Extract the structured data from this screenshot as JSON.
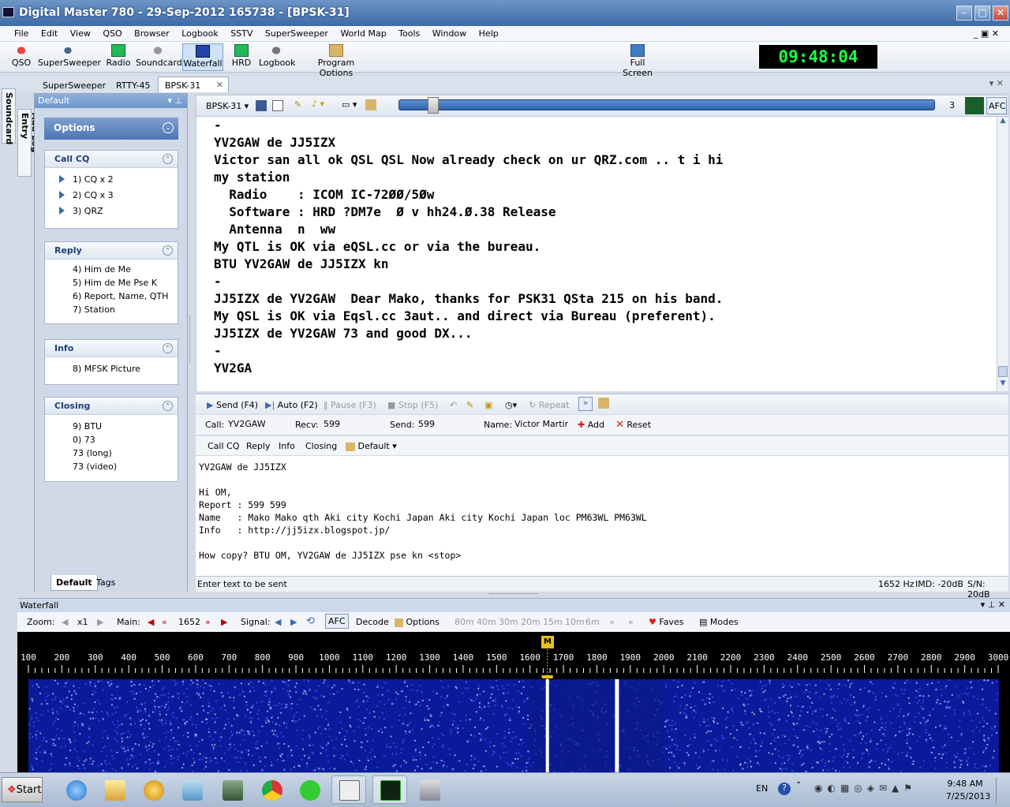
{
  "window": {
    "title": "Digital Master 780 - 29-Sep-2012 165738 - [BPSK-31]"
  },
  "menu": [
    "File",
    "Edit",
    "View",
    "QSO",
    "Browser",
    "Logbook",
    "SSTV",
    "SuperSweeper",
    "World Map",
    "Tools",
    "Window",
    "Help"
  ],
  "toolbar": {
    "buttons": [
      {
        "label": "QSO"
      },
      {
        "label": "SuperSweeper"
      },
      {
        "label": "Radio"
      },
      {
        "label": "Soundcard"
      },
      {
        "label": "Waterfall"
      },
      {
        "label": "HRD"
      },
      {
        "label": "Logbook"
      },
      {
        "label": "Program Options"
      },
      {
        "label": "Full Screen"
      }
    ],
    "clock": "09:48:04"
  },
  "doc_tabs": [
    "SuperSweeper",
    "RTTY-45",
    "BPSK-31"
  ],
  "side_tabs": [
    "Soundcard",
    "Add Log Entry"
  ],
  "left_panel": {
    "title": "Default",
    "options_label": "Options",
    "sections": [
      {
        "title": "Call CQ",
        "items": [
          "1)  CQ x 2",
          "2)  CQ x 3",
          "3)  QRZ"
        ]
      },
      {
        "title": "Reply",
        "items": [
          "4)  Him de Me",
          "5)  Him de Me Pse K",
          "6)  Report, Name, QTH",
          "7)  Station"
        ]
      },
      {
        "title": "Info",
        "items": [
          "8)  MFSK Picture"
        ]
      },
      {
        "title": "Closing",
        "items": [
          "9)  BTU",
          "0)  73",
          "73 (long)",
          "73 (video)"
        ]
      }
    ],
    "footer_tabs": [
      "Default",
      "Tags"
    ]
  },
  "rx_toolbar": {
    "mode": "BPSK-31",
    "level": "3",
    "afc": "AFC"
  },
  "rx_lines": [
    "-",
    "YV2GAW de JJ5IZX",
    "Victor san all ok QSL QSL Now already check on ur QRZ.com .. t i hi",
    "my station",
    "  Radio    : ICOM IC-72ØØ/5Øw",
    "  Software : HRD ?DM7e  Ø v hh24.Ø.38 Release",
    "  Antenna  n  ww",
    "My QTL is OK via eQSL.cc or via the bureau.",
    "BTU YV2GAW de JJ5IZX kn",
    "-",
    "JJ5IZX de YV2GAW  Dear Mako, thanks for PSK31 QSta 215 on his band.",
    "My QSL is OK via Eqsl.cc 3aut.. and direct via Bureau (preferent).",
    "JJ5IZX de YV2GAW 73 and good DX...",
    "-",
    "YV2GA"
  ],
  "tx_toolbar": {
    "send": "Send",
    "send_key": "(F4)",
    "auto": "Auto",
    "auto_key": "(F2)",
    "pause": "Pause",
    "pause_key": "(F3)",
    "stop": "Stop",
    "stop_key": "(F5)",
    "repeat": "Repeat"
  },
  "qso": {
    "call_label": "Call:",
    "call": "YV2GAW",
    "recv_label": "Recv:",
    "recv": "599",
    "send_label": "Send:",
    "send": "599",
    "name_label": "Name:",
    "name": "Victor Martin I",
    "add": "Add",
    "reset": "Reset"
  },
  "macro_bar": [
    "Call CQ",
    "Reply",
    "Info",
    "Closing",
    "Default"
  ],
  "tx_lines": [
    "YV2GAW de JJ5IZX",
    "",
    "Hi OM,",
    "Report : 599 599",
    "Name   : Mako Mako qth Aki city Kochi Japan Aki city Kochi Japan loc PM63WL PM63WL",
    "Info   : http://jj5izx.blogspot.jp/",
    "",
    "How copy? BTU OM, YV2GAW de JJ5IZX pse kn <stop>"
  ],
  "status": {
    "hint": "Enter text to be sent",
    "freq": "1652 Hz",
    "imd": "IMD: -20dB",
    "sn": "S/N: 20dB"
  },
  "waterfall": {
    "title": "Waterfall",
    "zoom_label": "Zoom:",
    "zoom": "x1",
    "main_label": "Main:",
    "main_freq": "1652",
    "signal_label": "Signal:",
    "afc": "AFC",
    "decode": "Decode",
    "options": "Options",
    "bands": [
      "80m",
      "40m",
      "30m",
      "20m",
      "15m",
      "10m",
      "6m"
    ],
    "faves": "Faves",
    "modes": "Modes",
    "marker": "M",
    "scale": [
      100,
      200,
      300,
      400,
      500,
      600,
      700,
      800,
      900,
      1000,
      1100,
      1200,
      1300,
      1400,
      1500,
      1600,
      1700,
      1800,
      1900,
      2000,
      2100,
      2200,
      2300,
      2400,
      2500,
      2600,
      2700,
      2800,
      2900,
      3000
    ]
  },
  "taskbar": {
    "start": "Start",
    "lang": "EN",
    "time": "9:48 AM",
    "date": "7/25/2013"
  },
  "colors": {
    "title_bar": "#3e6ba6",
    "clock_text": "#20ff40",
    "waterfall_bg": "#0a1a9a"
  }
}
